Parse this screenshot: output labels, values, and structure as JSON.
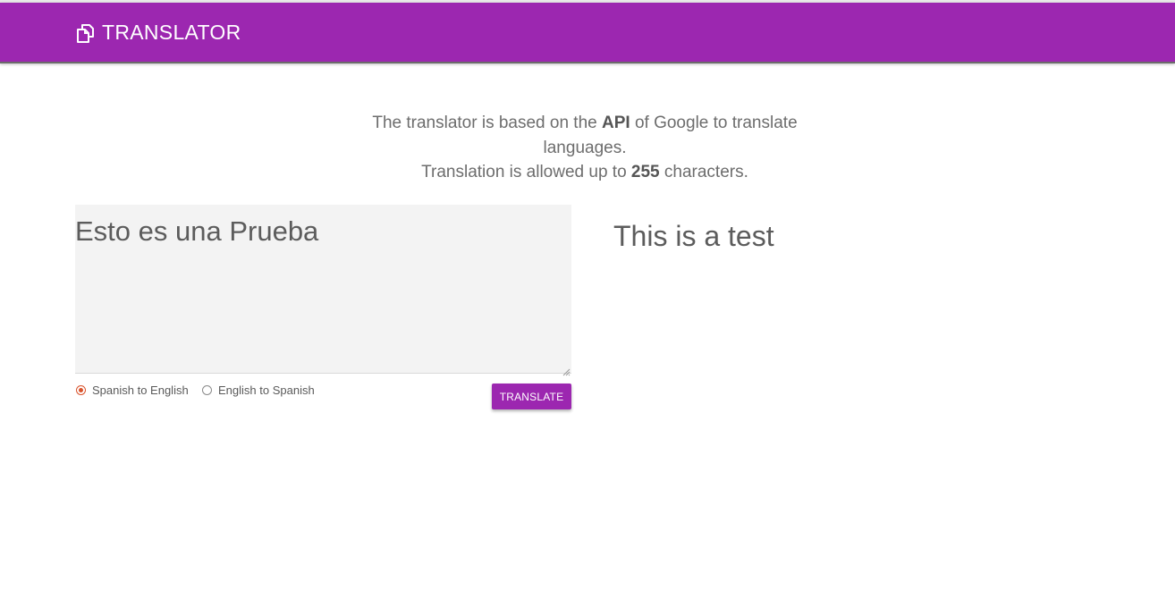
{
  "header": {
    "brand_icon": "copy-documents-icon",
    "title": "TRANSLATOR",
    "background_color": "#9c27b0"
  },
  "intro": {
    "line1_prefix": "The translator is based on the ",
    "line1_bold": "API",
    "line1_suffix": " of Google to translate languages.",
    "line2_prefix": "Translation is allowed up to ",
    "line2_bold": "255",
    "line2_suffix": " characters."
  },
  "source": {
    "value": "Esto es una Prueba",
    "resize_icon": "resize-grip-icon"
  },
  "direction": {
    "options": [
      {
        "label": "Spanish to English",
        "checked": true
      },
      {
        "label": "English to Spanish",
        "checked": false
      }
    ],
    "checked_color": "#d9532c"
  },
  "actions": {
    "translate_label": "TRANSLATE"
  },
  "result": {
    "text": "This is a test"
  }
}
